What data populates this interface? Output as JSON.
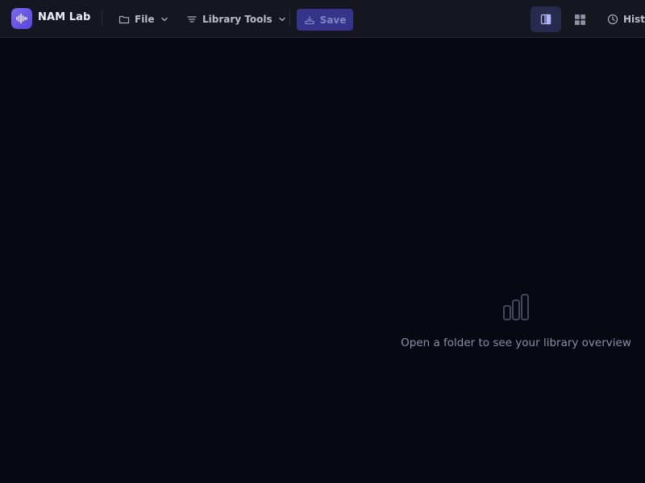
{
  "app": {
    "title": "NAM Lab",
    "logo_icon": "waveform-icon"
  },
  "toolbar": {
    "file_menu": {
      "label": "File",
      "icon": "folder-icon"
    },
    "library_tools_menu": {
      "label": "Library Tools",
      "icon": "filter-icon"
    },
    "save_button": {
      "label": "Save",
      "icon": "save-icon",
      "disabled": true
    },
    "view_buttons": [
      {
        "name": "columns-view",
        "icon": "columns-icon",
        "active": true
      },
      {
        "name": "grid-view",
        "icon": "grid-icon",
        "active": false
      }
    ],
    "history_button": {
      "label": "History",
      "icon": "clock-icon"
    }
  },
  "main": {
    "empty_state": {
      "icon": "bar-chart-icon",
      "message": "Open a folder to see your library overview"
    }
  },
  "colors": {
    "background": "#070812",
    "topbar": "#151620",
    "accent": "#6c5ce7",
    "save_button_bg": "#34358a",
    "active_view_bg": "#262a4c",
    "muted_text": "#8a8fa3"
  }
}
